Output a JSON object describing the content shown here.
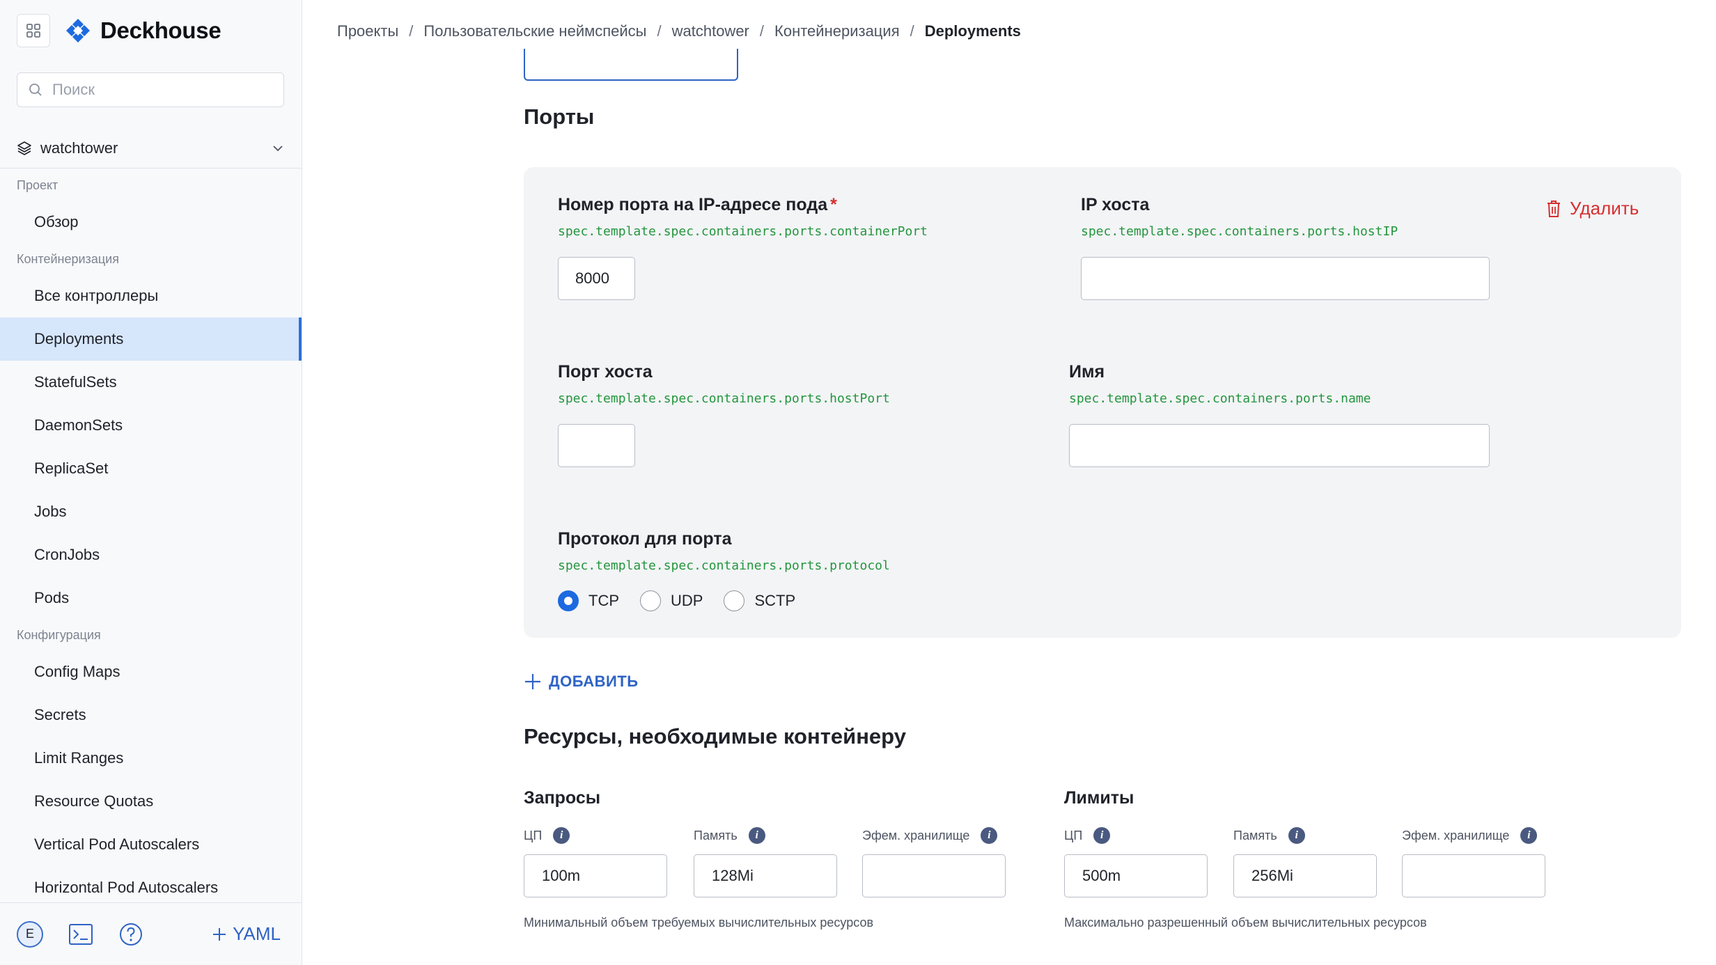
{
  "app": {
    "name": "Deckhouse"
  },
  "sidebar": {
    "search_placeholder": "Поиск",
    "namespace": "watchtower",
    "groups": [
      {
        "label": "Проект",
        "items": [
          "Обзор"
        ]
      },
      {
        "label": "Контейнеризация",
        "items": [
          "Все контроллеры",
          "Deployments",
          "StatefulSets",
          "DaemonSets",
          "ReplicaSet",
          "Jobs",
          "CronJobs",
          "Pods"
        ]
      },
      {
        "label": "Конфигурация",
        "items": [
          "Config Maps",
          "Secrets",
          "Limit Ranges",
          "Resource Quotas",
          "Vertical Pod Autoscalers",
          "Horizontal Pod Autoscalers"
        ]
      }
    ],
    "active_item": "Deployments",
    "bottom": {
      "user_initial": "E",
      "yaml_label": "YAML"
    }
  },
  "breadcrumb": [
    "Проекты",
    "Пользовательские неймспейсы",
    "watchtower",
    "Контейнеризация",
    "Deployments"
  ],
  "ports_section": {
    "title": "Порты",
    "delete_label": "Удалить",
    "container_port": {
      "label": "Номер порта на IP-адресе пода",
      "path": "spec.template.spec.containers.ports.containerPort",
      "value": "8000"
    },
    "host_ip": {
      "label": "IP хоста",
      "path": "spec.template.spec.containers.ports.hostIP",
      "value": ""
    },
    "host_port": {
      "label": "Порт хоста",
      "path": "spec.template.spec.containers.ports.hostPort",
      "value": ""
    },
    "name": {
      "label": "Имя",
      "path": "spec.template.spec.containers.ports.name",
      "value": ""
    },
    "protocol": {
      "label": "Протокол для порта",
      "path": "spec.template.spec.containers.ports.protocol",
      "options": [
        "TCP",
        "UDP",
        "SCTP"
      ],
      "selected": "TCP"
    },
    "add_label": "ДОБАВИТЬ"
  },
  "resources_section": {
    "title": "Ресурсы, необходимые контейнеру",
    "requests": {
      "title": "Запросы",
      "cpu_label": "ЦП",
      "cpu_value": "100m",
      "memory_label": "Память",
      "memory_value": "128Mi",
      "ephemeral_label": "Эфем. хранилище",
      "ephemeral_value": "",
      "hint": "Минимальный объем требуемых вычислительных ресурсов"
    },
    "limits": {
      "title": "Лимиты",
      "cpu_label": "ЦП",
      "cpu_value": "500m",
      "memory_label": "Память",
      "memory_value": "256Mi",
      "ephemeral_label": "Эфем. хранилище",
      "ephemeral_value": "",
      "hint": "Максимально разрешенный объем вычислительных ресурсов"
    }
  },
  "colors": {
    "accent": "#2f63c4",
    "danger": "#d62f2f",
    "path_green": "#24963e",
    "active_bg": "#d6e6fb"
  }
}
